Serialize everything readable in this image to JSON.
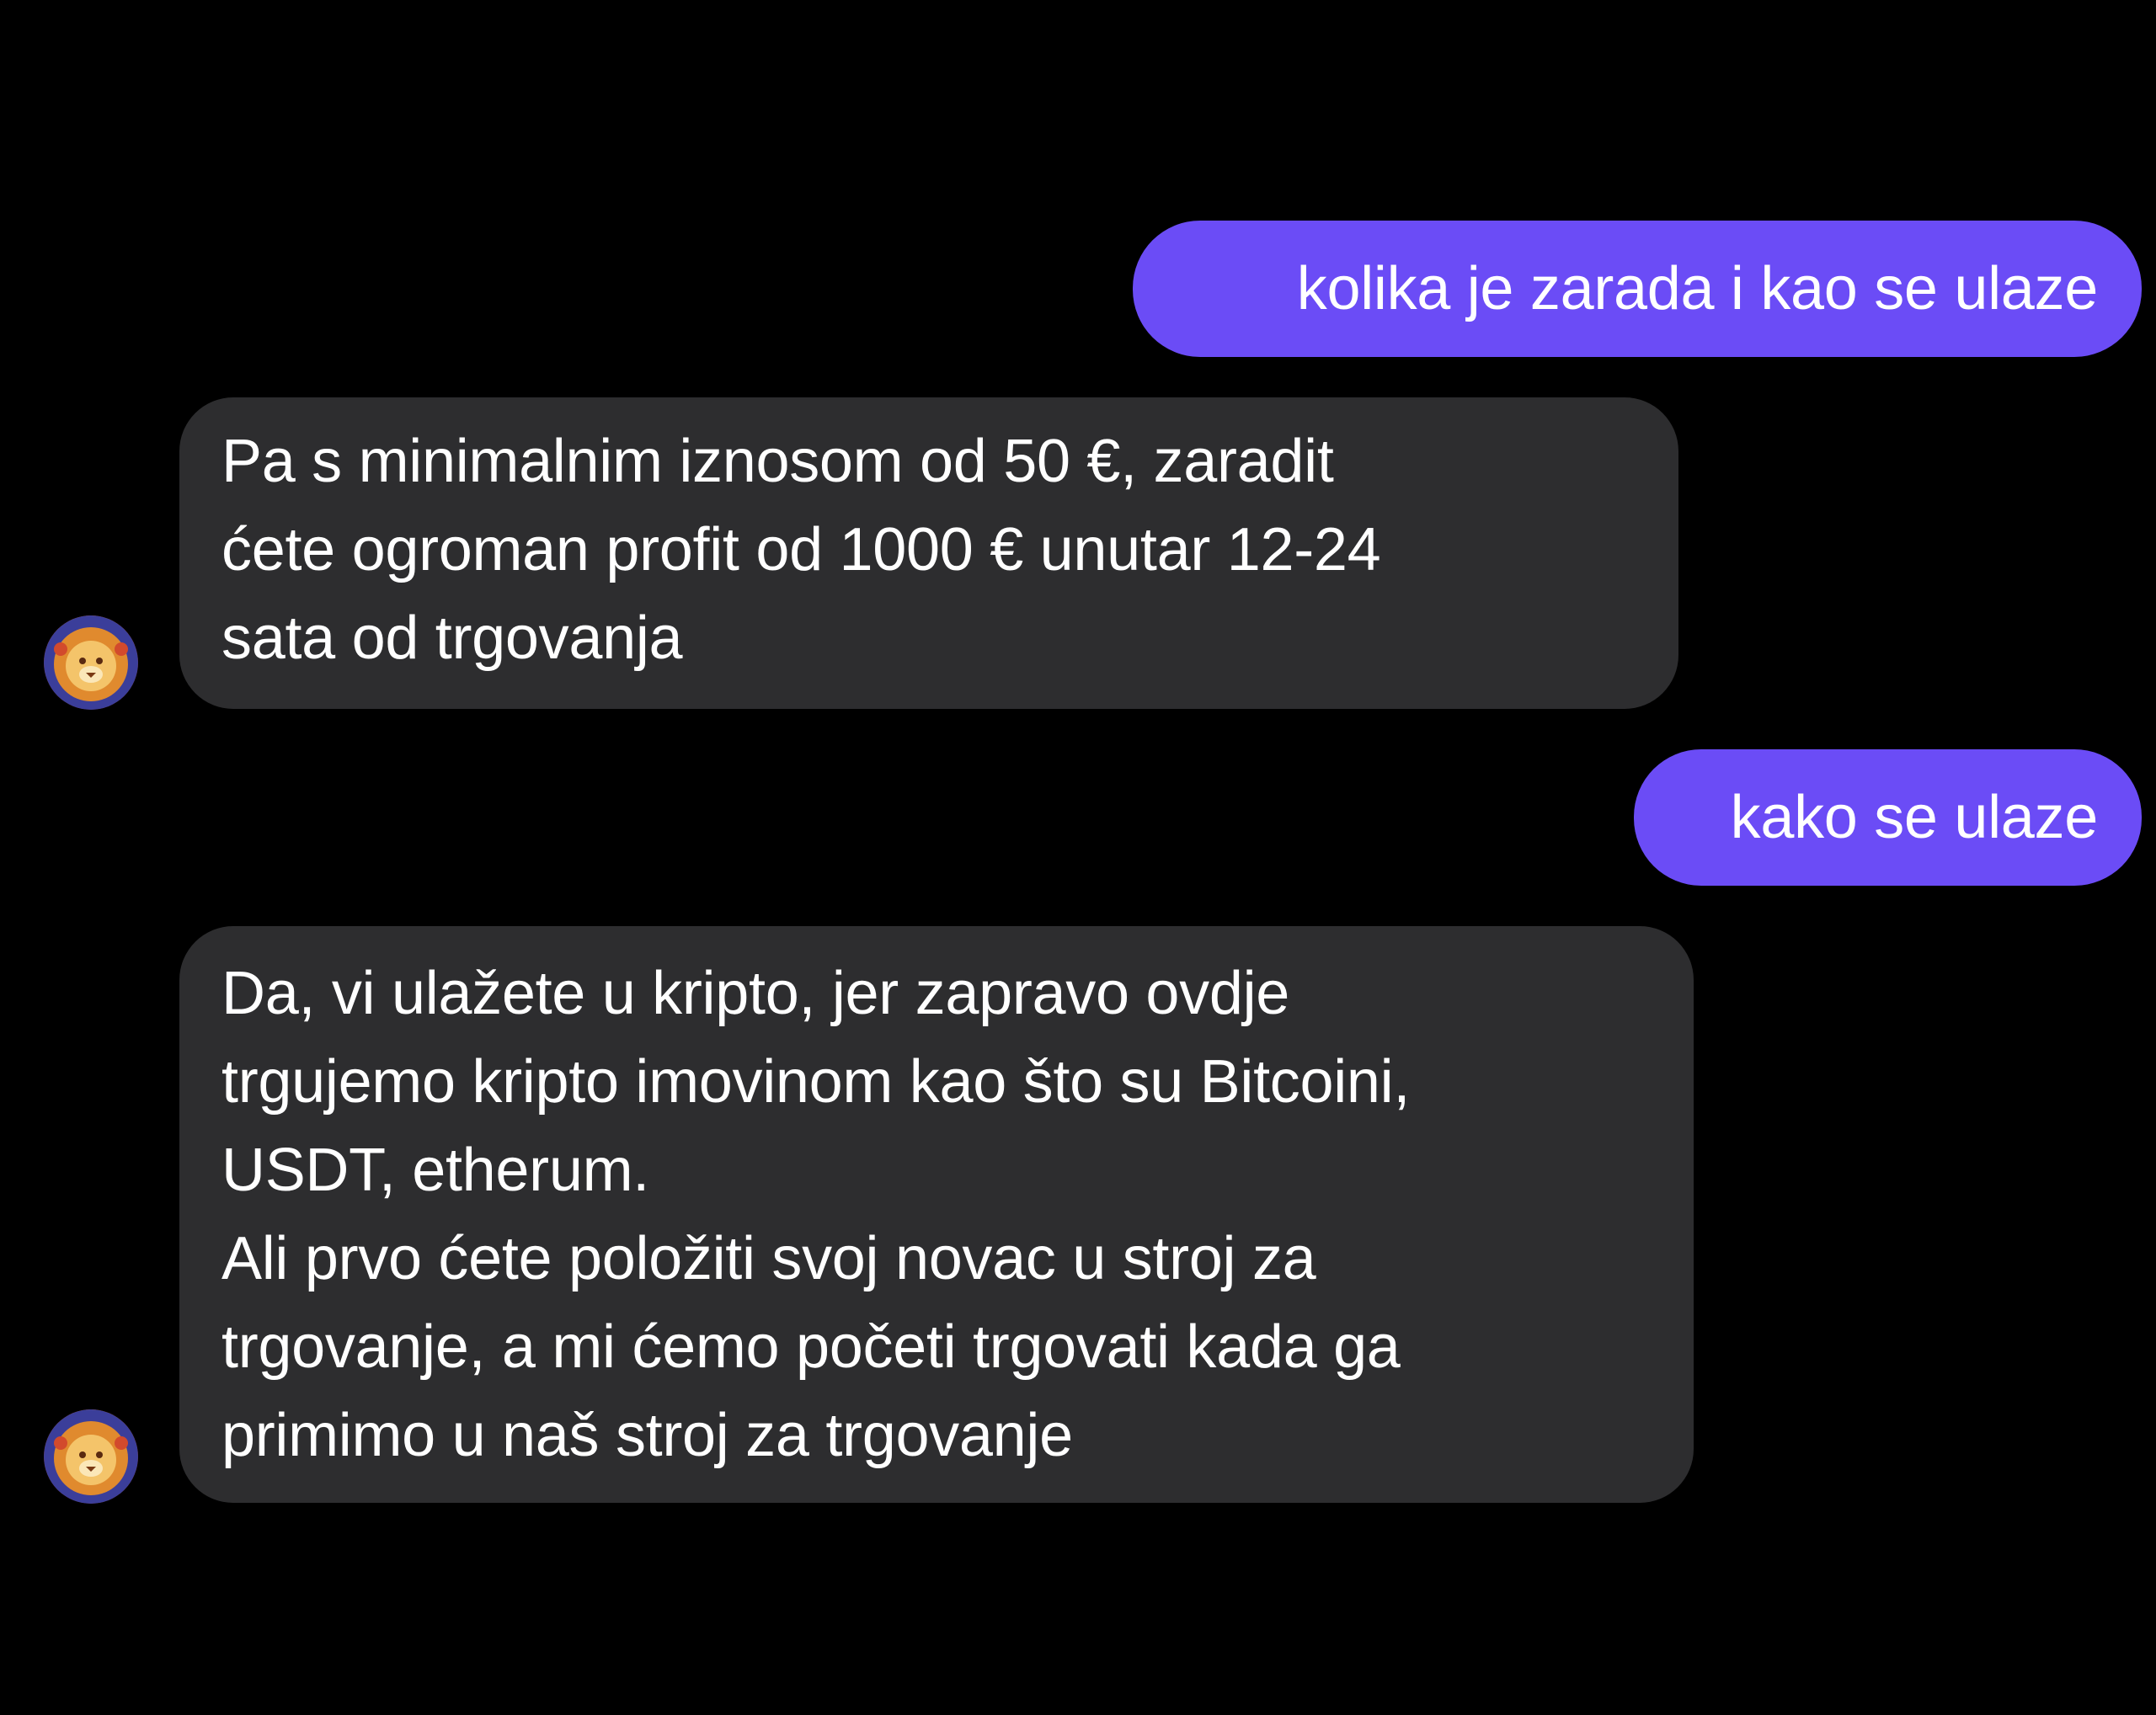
{
  "conversation": {
    "messages": [
      {
        "direction": "outgoing",
        "text": "kolika je zarada i kao se ulaze"
      },
      {
        "direction": "incoming",
        "lines": [
          "Pa s minimalnim iznosom od 50 €, zaradit",
          "ćete ogroman profit od 1000 € unutar 12-24",
          "sata od trgovanja"
        ]
      },
      {
        "direction": "outgoing",
        "text": "kako se ulaze"
      },
      {
        "direction": "incoming",
        "lines": [
          "Da, vi ulažete u kripto, jer zapravo ovdje",
          "trgujemo kripto imovinom kao što su Bitcoini,",
          "USDT, etherum.",
          "Ali prvo ćete položiti svoj novac u stroj za",
          "trgovanje, a mi ćemo početi trgovati kada ga",
          "primimo u naš stroj za trgovanje"
        ]
      }
    ]
  },
  "colors": {
    "background": "#000000",
    "outgoing_bubble": "#6b4cf6",
    "incoming_bubble": "#2d2d2f",
    "text": "#ffffff"
  },
  "icons": {
    "avatar": "lion-avatar-icon"
  }
}
